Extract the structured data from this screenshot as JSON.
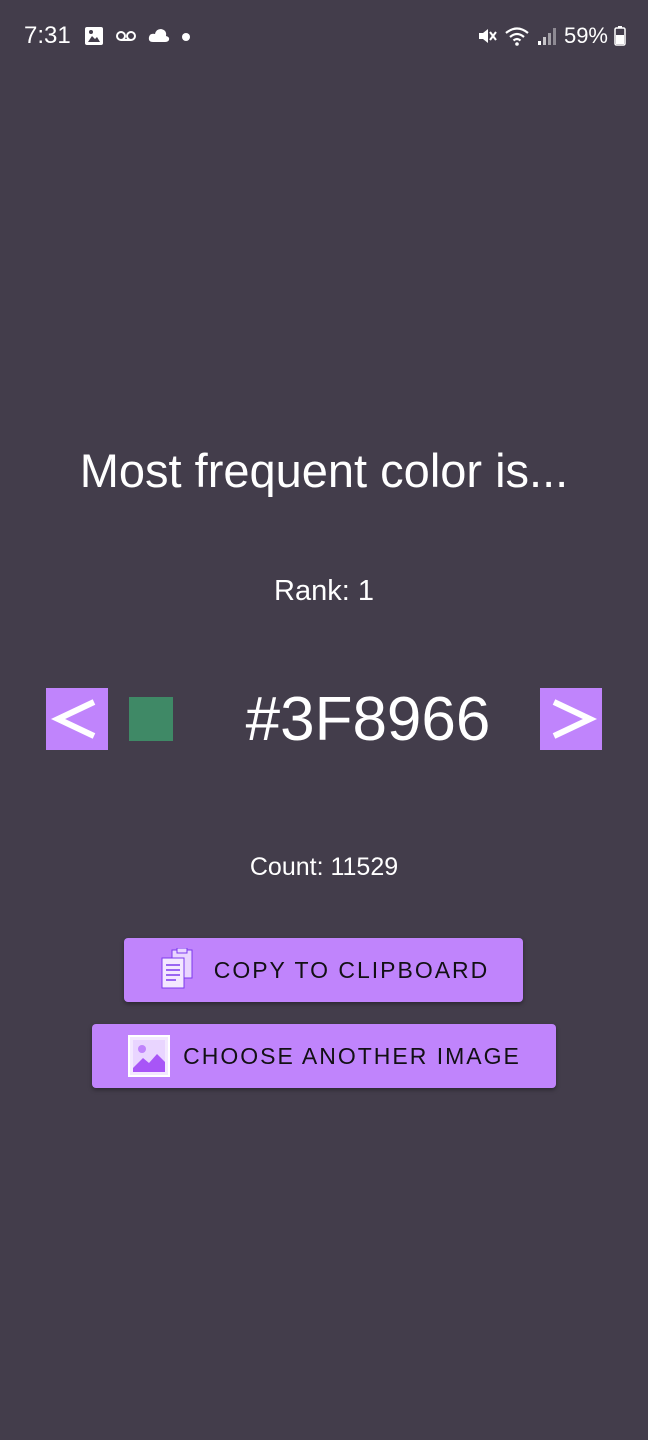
{
  "status_bar": {
    "time": "7:31",
    "battery": "59%",
    "icons_left": [
      "image-icon",
      "voicemail-icon",
      "cloud-icon",
      "dot-icon"
    ],
    "icons_right": [
      "mute-icon",
      "wifi-icon",
      "signal-icon",
      "battery-icon"
    ]
  },
  "main": {
    "headline": "Most frequent color is...",
    "rank": "Rank: 1",
    "prev_label": "<",
    "next_label": ">",
    "hex": "#3F8966",
    "swatch_color": "#3F8966",
    "count": "Count: 11529"
  },
  "actions": {
    "copy_label": "COPY TO CLIPBOARD",
    "choose_label": "CHOOSE ANOTHER IMAGE"
  },
  "colors": {
    "background": "#433d4b",
    "accent": "#c084fc"
  }
}
